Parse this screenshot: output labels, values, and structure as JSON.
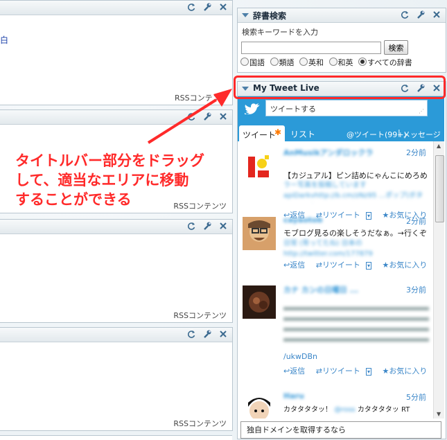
{
  "left_widgets": [
    {
      "footer": "",
      "content": "白"
    },
    {
      "footer": "RSSコンテンツ"
    },
    {
      "footer": "RSSコンテンツ"
    },
    {
      "footer": "RSSコンテンツ"
    },
    {
      "footer": "RSSコンテンツ"
    }
  ],
  "dictionary": {
    "title": "辞書検索",
    "prompt": "検索キーワードを入力",
    "search_button": "検索",
    "search_value": "",
    "options": [
      "国語",
      "類語",
      "英和",
      "和英",
      "すべての辞書"
    ],
    "selected": "すべての辞書"
  },
  "twitter": {
    "title": "My Tweet Live",
    "compose_placeholder": "ツイートする",
    "tabs": {
      "tweets": "ツイート",
      "list": "リスト",
      "mentions": "@ツイート(99+)",
      "messages": "メッセージ",
      "separator": "|"
    },
    "actions": {
      "reply": "返信",
      "retweet": "リツイート",
      "favorite": "お気に入り"
    },
    "tweets": [
      {
        "time": "2分前",
        "name": "AnMusikアンダロックラ",
        "text": "【カジュアル】ピン詰めにゃんこにめろめ",
        "blurred": "ラー写真を投稿しています apiDarkvhttp://b.cm/zNz95 ...ポップ(ボタン) ファクト bit.ly"
      },
      {
        "time": "2分前",
        "name": "cayaotob",
        "text": "モブログ見るの楽しそうだなぁ。→行くぞ",
        "blurred": "日常 (背ってたね) 日本の http://twitter.com/177879"
      },
      {
        "time": "3分前",
        "name": "カナ カンの日曜日 ...",
        "text": "",
        "blurred": "@ ... ",
        "link": "/ukwDBn"
      },
      {
        "time": "5分前",
        "name": "Haru",
        "text": "カタタタタッ！",
        "text2": "カタタタタッ RT"
      }
    ]
  },
  "bottom_panel": {
    "text": "独自ドメインを取得するなら"
  },
  "annotation": {
    "lines": [
      "タイトルバー部分をドラッグ",
      "して、適当なエリアに移動",
      "することができる"
    ]
  },
  "colors": {
    "accent_red": "#ff2a2a",
    "twitter_bar": "#2b9ad8",
    "link": "#3a86c8"
  }
}
